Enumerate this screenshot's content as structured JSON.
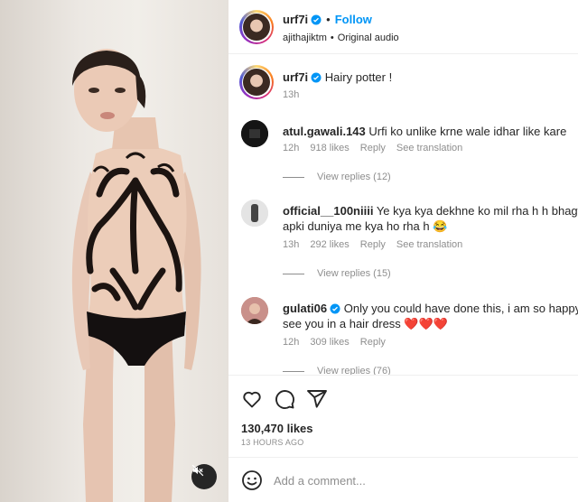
{
  "post": {
    "username": "urf7i",
    "follow_label": "Follow",
    "separator": "•",
    "audio_owner": "ajithajiktm",
    "audio_label": "Original audio"
  },
  "caption": {
    "username": "urf7i",
    "text": "Hairy potter !",
    "time": "13h"
  },
  "comments": [
    {
      "username": "atul.gawali.143",
      "text": "Urfi ko unlike krne wale idhar like kare",
      "text2": "",
      "time": "12h",
      "likes": "918 likes",
      "reply": "Reply",
      "translate": "See translation",
      "view_replies": "View replies (12)"
    },
    {
      "username": "official__100niiii",
      "text": "Ye kya kya dekhne ko mil rha h h bhagwan",
      "text2": "apki duniya me kya ho rha h 😂",
      "time": "13h",
      "likes": "292 likes",
      "reply": "Reply",
      "translate": "See translation",
      "view_replies": "View replies (15)"
    },
    {
      "username": "gulati06",
      "text": "Only you could have done this, i am so happy to",
      "text2": "see you in a hair dress ❤️❤️❤️",
      "time": "12h",
      "likes": "309 likes",
      "reply": "Reply",
      "translate": "",
      "view_replies": "View replies (76)"
    }
  ],
  "stats": {
    "likes": "130,470 likes",
    "ago": "13 HOURS AGO"
  },
  "add_comment": {
    "placeholder": "Add a comment..."
  },
  "icons": [
    "verified-badge-icon",
    "heart-icon",
    "comment-icon",
    "share-icon",
    "emoji-icon",
    "mute-icon"
  ],
  "colors": {
    "accent": "#0095f6",
    "muted": "#8e8e8e",
    "text": "#262626"
  }
}
